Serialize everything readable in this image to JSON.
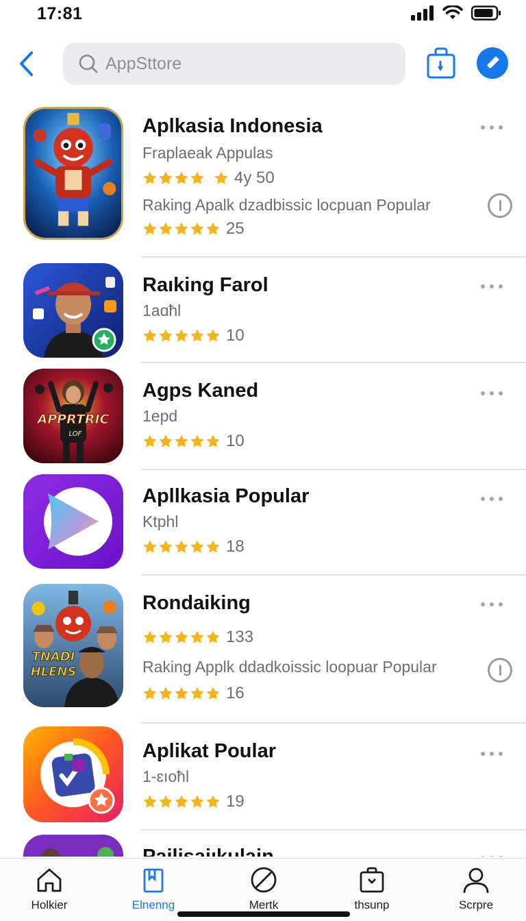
{
  "status": {
    "time": "17:81"
  },
  "search": {
    "placeholder": "AppSttore"
  },
  "apps": [
    {
      "name": "Aplkasia Indonesia",
      "subtitle": "Fraplaeak Appulas",
      "rating": "4y 50",
      "description": "Raking Apalk dzadbissic locpuan Popular",
      "rating2": "25",
      "icon": "cartoon-character-icon"
    },
    {
      "name": "Raıking Farol",
      "subtitle": "1aɑħl",
      "rating": "10",
      "icon": "man-with-cap-icon"
    },
    {
      "name": "Agps Kaned",
      "subtitle": "1epd",
      "rating": "10",
      "icon": "apprtric-game-icon",
      "icon_text": "APPRTRIC",
      "icon_subtext": "LOF"
    },
    {
      "name": "Apllkasia Popular",
      "subtitle": "Ktphl",
      "rating": "18",
      "icon": "play-triangle-icon"
    },
    {
      "name": "Rondaiking",
      "rating": "133",
      "description": "Raking Applk ddadkoissic loopuar Popular",
      "rating2": "16",
      "icon": "tnadi-hlens-icon",
      "icon_text": "TNADI",
      "icon_subtext": "HLENS"
    },
    {
      "name": "Aplikat Poular",
      "subtitle": "1-ɛıoħl",
      "rating": "19",
      "icon": "music-star-icon"
    },
    {
      "name": "Pailisaiıkulain",
      "icon": "partial-app-icon"
    }
  ],
  "tabs": [
    {
      "label": "Holkier",
      "icon": "home-icon"
    },
    {
      "label": "Elnenng",
      "icon": "bookmark-icon",
      "active": true
    },
    {
      "label": "Mertk",
      "icon": "slash-circle-icon"
    },
    {
      "label": "thsunp",
      "icon": "shopping-bag-icon"
    },
    {
      "label": "Scrpre",
      "icon": "profile-icon"
    }
  ],
  "colors": {
    "accent": "#1877ea",
    "star": "#f5b51a",
    "secondary_text": "#6d6d72"
  }
}
